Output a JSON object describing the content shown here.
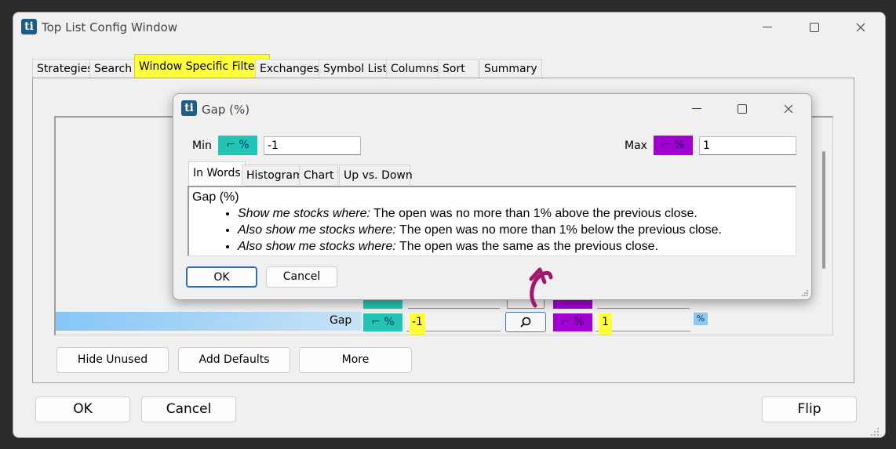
{
  "main_window": {
    "title": "Top List Config Window",
    "logo": "ti",
    "controls": {
      "minimize_icon": "minimize-icon",
      "maximize_icon": "maximize-icon",
      "close_icon": "close-icon"
    },
    "tabs": [
      {
        "label": "Strategies"
      },
      {
        "label": "Search"
      },
      {
        "label": "Window Specific Filters",
        "active": true
      },
      {
        "label": "Exchanges"
      },
      {
        "label": "Symbol Lists"
      },
      {
        "label": "Columns"
      },
      {
        "label": "Sort"
      },
      {
        "label": "Summary"
      }
    ],
    "filter_row": {
      "label": "Gap",
      "min_value": "-1",
      "max_value": "1",
      "unit_icon": "%",
      "scale_icon": "⌐ %"
    },
    "panel_buttons": {
      "hide_unused": "Hide Unused",
      "add_defaults": "Add Defaults",
      "more": "More"
    },
    "footer_buttons": {
      "ok": "OK",
      "cancel": "Cancel",
      "flip": "Flip"
    }
  },
  "dialog": {
    "title": "Gap (%)",
    "logo": "ti",
    "min_label": "Min",
    "min_value": "-1",
    "max_label": "Max",
    "max_value": "1",
    "scale_icon": "⌐ %",
    "tabs": [
      {
        "label": "In Words",
        "active": true
      },
      {
        "label": "Histogram"
      },
      {
        "label": "Chart"
      },
      {
        "label": "Up vs. Down"
      }
    ],
    "description": {
      "heading": "Gap (%)",
      "items": [
        {
          "prefix": "Show me stocks where:",
          "text": " The open was no more than 1% above the previous close."
        },
        {
          "prefix": "Also show me stocks where:",
          "text": " The open was no more than 1% below the previous close."
        },
        {
          "prefix": "Also show me stocks where:",
          "text": " The open was the same as the previous close."
        }
      ]
    },
    "buttons": {
      "ok": "OK",
      "cancel": "Cancel"
    }
  },
  "colors": {
    "highlight": "#ffff3a",
    "teal": "#23c3b5",
    "purple": "#a200d0",
    "row_bar": "#86c6f6",
    "annotation_arrow": "#a0186a"
  }
}
